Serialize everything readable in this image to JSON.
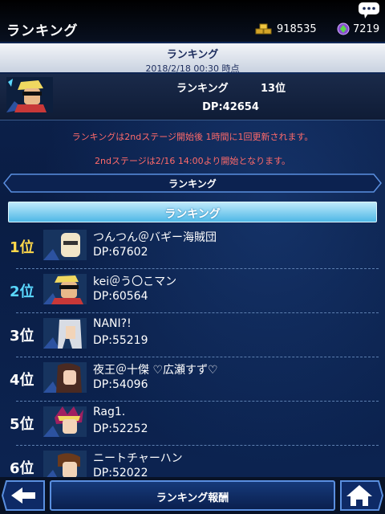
{
  "topbar": {
    "title": "ランキング",
    "gold": "918535",
    "gems": "7219"
  },
  "banner": {
    "title": "ランキング",
    "timestamp": "2018/2/18 00:30 時点"
  },
  "my_ranking": {
    "label": "ランキング",
    "rank": "13位",
    "dp": "DP:42654"
  },
  "notices": [
    "ランキングは2ndステージ開始後 1時間に1回更新されます。",
    "2ndステージは2/16 14:00より開始となります。"
  ],
  "section_header": "ランキング",
  "tab_label": "ランキング",
  "rankings": [
    {
      "rank": "1位",
      "name": "つんつん＠バギー海賊団",
      "dp": "DP:67602",
      "rank_color": "#ffd84a"
    },
    {
      "rank": "2位",
      "name": "kei＠う〇こマン",
      "dp": "DP:60564",
      "rank_color": "#5ad8ff"
    },
    {
      "rank": "3位",
      "name": "NANI?!",
      "dp": "DP:55219",
      "rank_color": "#ffffff"
    },
    {
      "rank": "4位",
      "name": "夜王＠十傑 ♡広瀬すず♡",
      "dp": "DP:54096",
      "rank_color": "#ffffff"
    },
    {
      "rank": "5位",
      "name": "Rag1.",
      "dp": "DP:52252",
      "rank_color": "#ffffff"
    },
    {
      "rank": "6位",
      "name": "ニートチャーハン",
      "dp": "DP:52022",
      "rank_color": "#ffffff"
    }
  ],
  "bottom": {
    "reward_label": "ランキング報酬"
  },
  "icons": {
    "chat": "chat-bubble-icon",
    "gold": "gold-bars-icon",
    "gem": "gem-icon",
    "back": "back-arrow-icon",
    "home": "home-icon"
  },
  "colors": {
    "accent_blue": "#4fb8e6",
    "notice_red": "#ff6a6a",
    "first_gold": "#ffd84a",
    "second_cyan": "#5ad8ff"
  }
}
